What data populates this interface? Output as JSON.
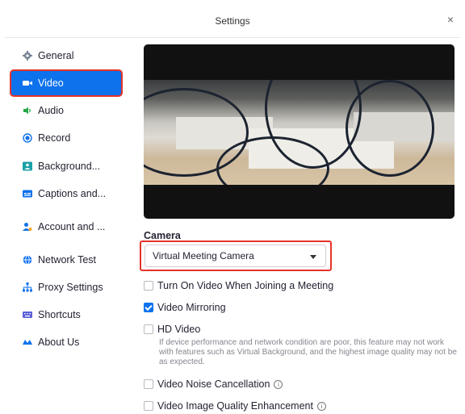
{
  "window": {
    "title": "Settings",
    "close_glyph": "×"
  },
  "sidebar": {
    "items": [
      {
        "label": "General",
        "icon": "gear-icon",
        "active": false
      },
      {
        "label": "Video",
        "icon": "video-camera-icon",
        "active": true
      },
      {
        "label": "Audio",
        "icon": "speaker-icon",
        "active": false
      },
      {
        "label": "Record",
        "icon": "record-icon",
        "active": false
      },
      {
        "label": "Background...",
        "icon": "background-icon",
        "active": false
      },
      {
        "label": "Captions and...",
        "icon": "captions-icon",
        "active": false
      },
      {
        "label": "Account and ...",
        "icon": "account-icon",
        "active": false
      },
      {
        "label": "Network Test",
        "icon": "globe-icon",
        "active": false
      },
      {
        "label": "Proxy Settings",
        "icon": "network-tree-icon",
        "active": false
      },
      {
        "label": "Shortcuts",
        "icon": "keyboard-icon",
        "active": false
      },
      {
        "label": "About Us",
        "icon": "zoom-logo-icon",
        "active": false
      }
    ]
  },
  "video": {
    "camera_label": "Camera",
    "camera_select": {
      "value": "Virtual Meeting Camera"
    },
    "options": {
      "turn_on_video": {
        "label": "Turn On Video When Joining a Meeting",
        "checked": false
      },
      "mirroring": {
        "label": "Video Mirroring",
        "checked": true
      },
      "hd_video": {
        "label": "HD Video",
        "checked": false
      },
      "hd_hint": "If device performance and network condition are poor, this feature may not work with features such as Virtual Background, and the highest image quality may not be as expected.",
      "noise_cancellation": {
        "label": "Video Noise Cancellation",
        "checked": false
      },
      "quality_enhancement": {
        "label": "Video Image Quality Enhancement",
        "checked": false
      }
    }
  },
  "colors": {
    "accent": "#0e72ed",
    "highlight": "#e5332a"
  }
}
